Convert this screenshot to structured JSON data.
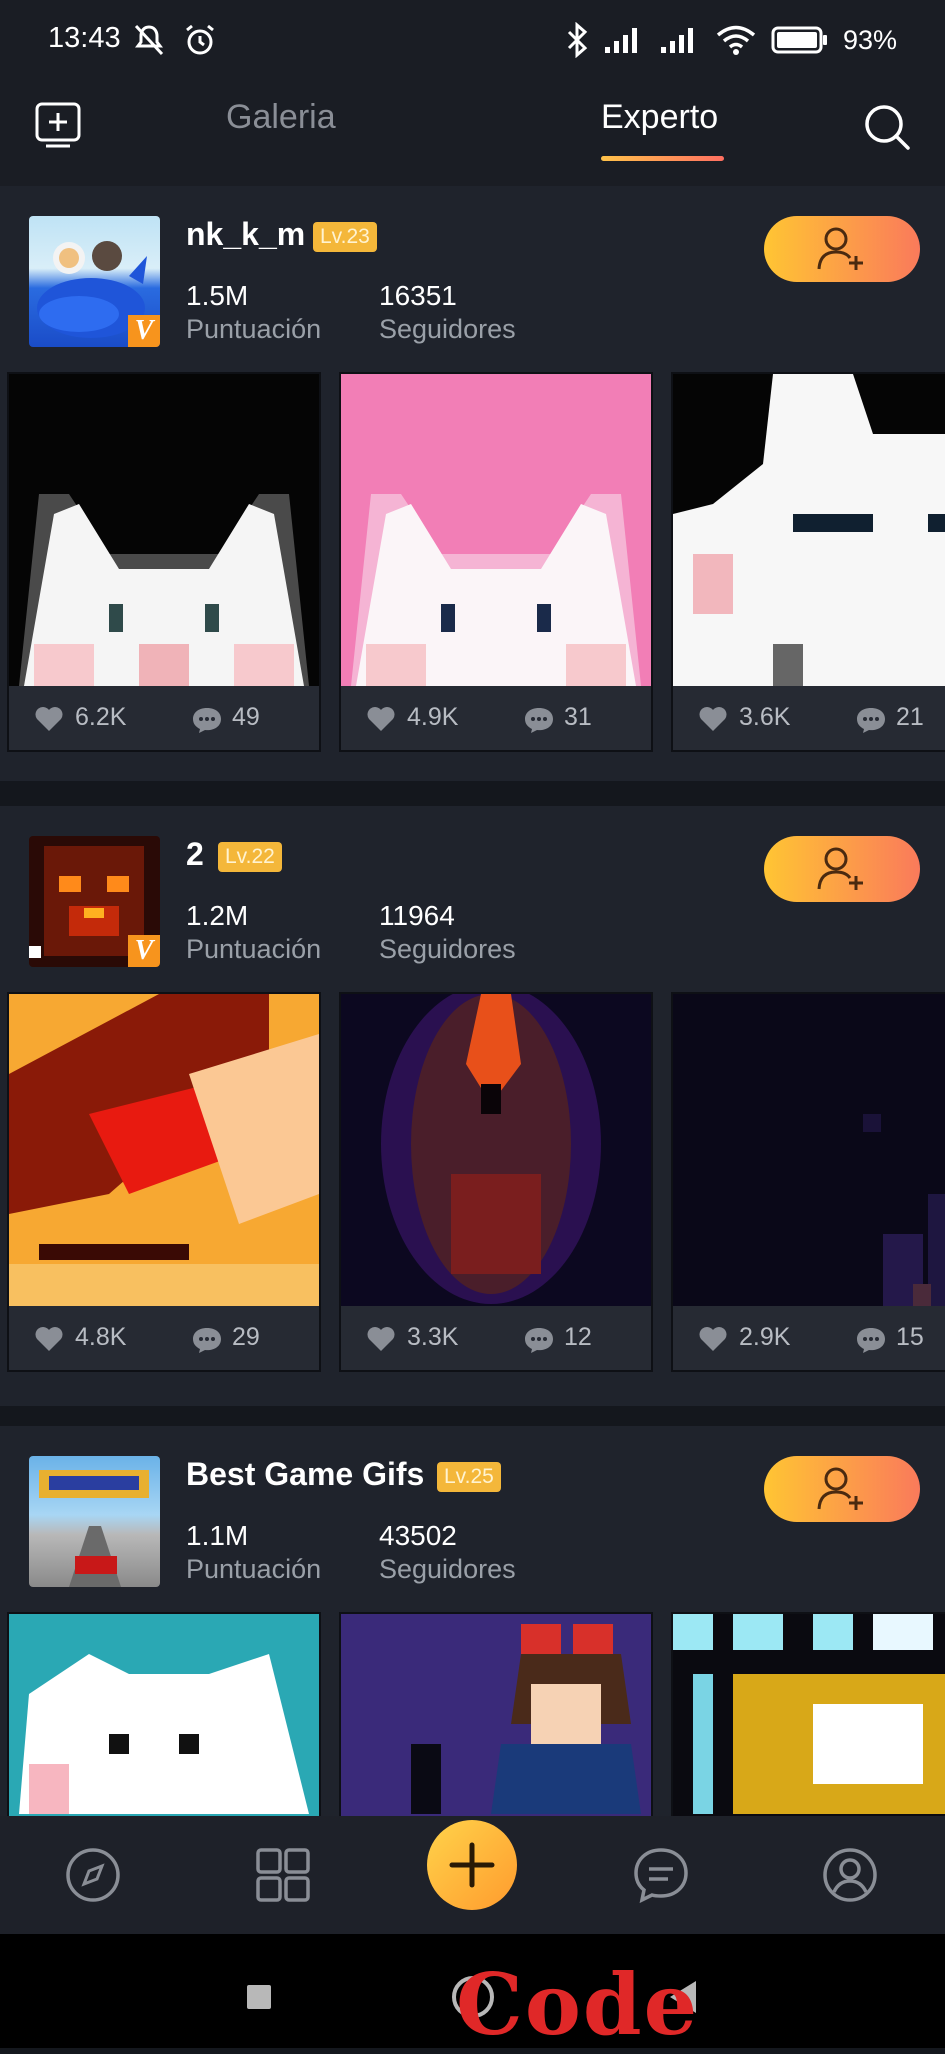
{
  "status_bar": {
    "time": "13:43",
    "battery": "93%"
  },
  "top_nav": {
    "tabs": [
      "Galeria",
      "Experto"
    ],
    "active_tab": "Experto"
  },
  "users": [
    {
      "name": "nk_k_m",
      "level": "Lv.23",
      "score": "1.5M",
      "score_label": "Puntuación",
      "followers": "16351",
      "followers_label": "Seguidores",
      "artworks": [
        {
          "likes": "6.2K",
          "comments": "49"
        },
        {
          "likes": "4.9K",
          "comments": "31"
        },
        {
          "likes": "3.6K",
          "comments": "21"
        }
      ]
    },
    {
      "name": "2",
      "level": "Lv.22",
      "score": "1.2M",
      "score_label": "Puntuación",
      "followers": "11964",
      "followers_label": "Seguidores",
      "artworks": [
        {
          "likes": "4.8K",
          "comments": "29"
        },
        {
          "likes": "3.3K",
          "comments": "12"
        },
        {
          "likes": "2.9K",
          "comments": "15"
        }
      ]
    },
    {
      "name": "Best Game Gifs",
      "level": "Lv.25",
      "score": "1.1M",
      "score_label": "Puntuación",
      "followers": "43502",
      "followers_label": "Seguidores",
      "artworks": []
    }
  ],
  "verified_badge": "V",
  "watermark": "Code",
  "colors": {
    "accent_start": "#ffc533",
    "accent_end": "#fa7a5b",
    "background": "#14171d",
    "card": "#1f232c"
  }
}
